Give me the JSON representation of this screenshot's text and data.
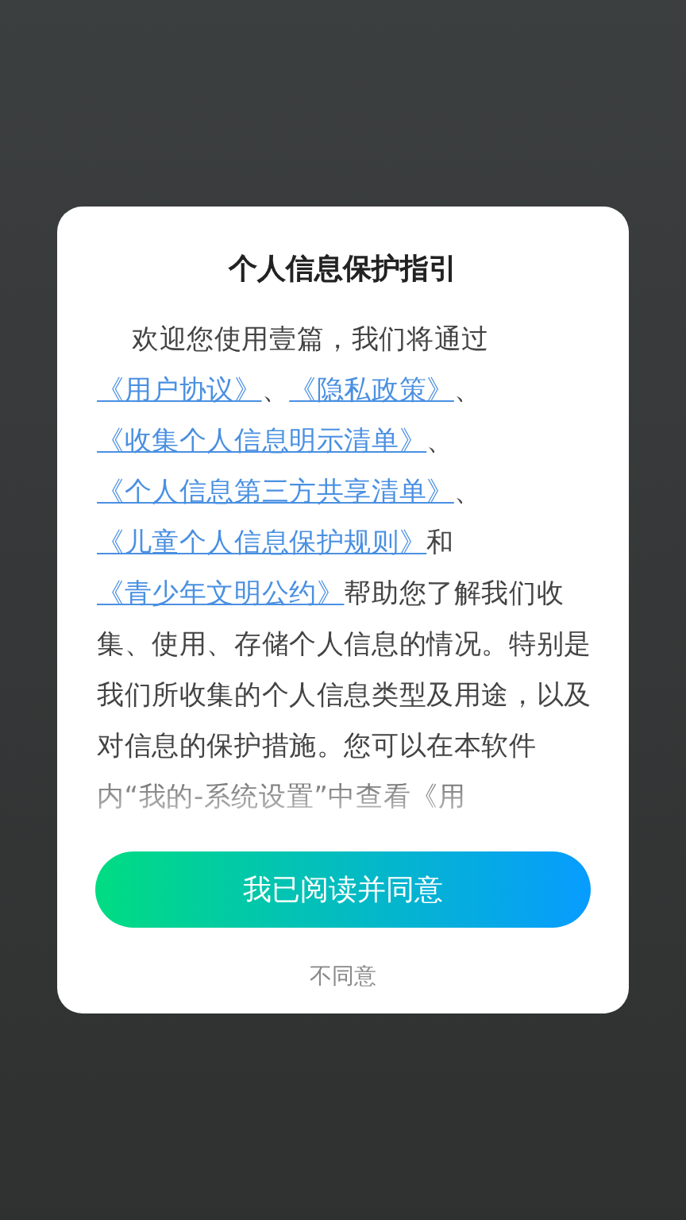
{
  "dialog": {
    "title": "个人信息保护指引",
    "body": [
      {
        "kind": "text",
        "text": "欢迎您使用壹篇，我们将通过"
      },
      {
        "kind": "link",
        "text": "《用户协议》"
      },
      {
        "kind": "text",
        "text": "、"
      },
      {
        "kind": "link",
        "text": "《隐私政策》"
      },
      {
        "kind": "text",
        "text": "、"
      },
      {
        "kind": "link",
        "text": "《收集个人信息明示清单》"
      },
      {
        "kind": "text",
        "text": "、"
      },
      {
        "kind": "link",
        "text": "《个人信息第三方共享清单》"
      },
      {
        "kind": "text",
        "text": "、"
      },
      {
        "kind": "link",
        "text": "《儿童个人信息保护规则》"
      },
      {
        "kind": "text",
        "text": "和"
      },
      {
        "kind": "link",
        "text": "《青少年文明公约》"
      },
      {
        "kind": "text",
        "text": "帮助您了解我们收集、使用、存储个人信息的情况。特别是我们所收集的个人信息类型及用途，以及对信息的保护措施。您可以在本软件内“我的-系统设置”中查看《用"
      }
    ],
    "agree_button": "我已阅读并同意",
    "decline_link": "不同意"
  }
}
